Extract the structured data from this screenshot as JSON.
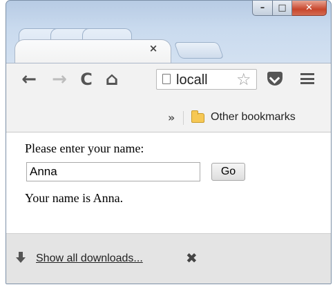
{
  "window": {
    "controls": {
      "minimize_glyph": "–",
      "maximize_glyph": "□",
      "close_glyph": "✕"
    }
  },
  "tab": {
    "close_glyph": "×"
  },
  "toolbar": {
    "back_glyph": "←",
    "forward_glyph": "→",
    "reload_glyph": "C",
    "home_glyph": "⌂",
    "url": "locall",
    "star_glyph": "☆"
  },
  "bookmarks": {
    "overflow_glyph": "»",
    "other_bookmarks_label": "Other bookmarks"
  },
  "page": {
    "prompt": "Please enter your name:",
    "name_value": "Anna",
    "go_label": "Go",
    "result": "Your name is Anna."
  },
  "downloads": {
    "show_all_label": "Show all downloads...",
    "close_glyph": "✖"
  },
  "colors": {
    "frame": "#c9daee",
    "toolbar": "#f2f2f2",
    "downloads_bar": "#e4e4e4",
    "close_button": "#c8462c",
    "folder": "#f6c855"
  }
}
